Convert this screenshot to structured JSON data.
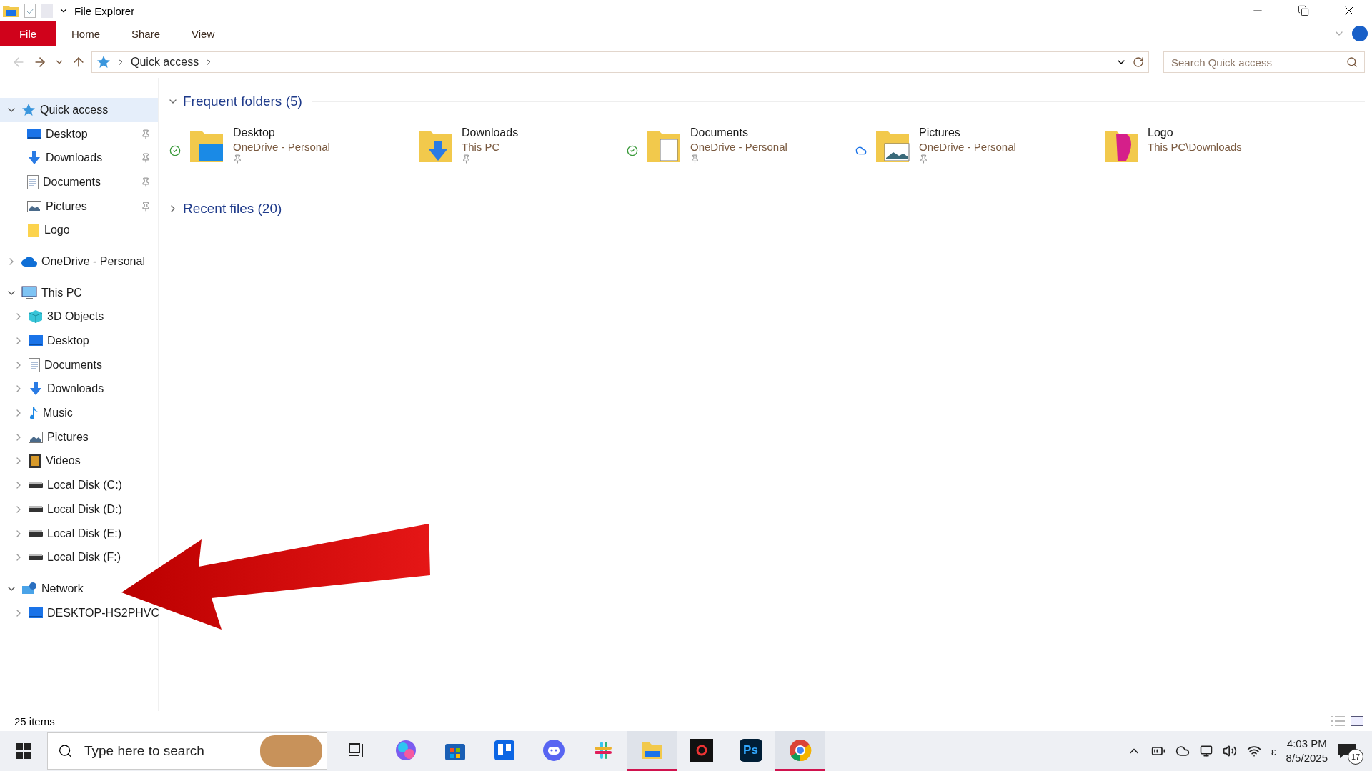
{
  "window": {
    "title": "File Explorer"
  },
  "ribbon": {
    "tabs": [
      {
        "label": "File",
        "kind": "file",
        "selected": false
      },
      {
        "label": "Home",
        "kind": "tab",
        "selected": false
      },
      {
        "label": "Share",
        "kind": "tab",
        "selected": false
      },
      {
        "label": "View",
        "kind": "tab",
        "selected": false
      }
    ]
  },
  "address": {
    "path": [
      "Quick access"
    ],
    "search_placeholder": "Search Quick access"
  },
  "sidebar": {
    "sections": [
      {
        "label": "Quick access",
        "kind": "star",
        "expanded": true,
        "selected": true,
        "children": [
          {
            "label": "Desktop",
            "kind": "desktop",
            "pinned": true
          },
          {
            "label": "Downloads",
            "kind": "downloads",
            "pinned": true
          },
          {
            "label": "Documents",
            "kind": "documents",
            "pinned": true
          },
          {
            "label": "Pictures",
            "kind": "pictures",
            "pinned": true
          },
          {
            "label": "Logo",
            "kind": "folder",
            "pinned": false
          }
        ]
      },
      {
        "label": "OneDrive - Personal",
        "kind": "cloud",
        "expanded": false,
        "selected": false
      },
      {
        "label": "This PC",
        "kind": "pc",
        "expanded": true,
        "selected": false,
        "children": [
          {
            "label": "3D Objects",
            "kind": "cube",
            "expanded": false
          },
          {
            "label": "Desktop",
            "kind": "desktop",
            "expanded": false
          },
          {
            "label": "Documents",
            "kind": "documents",
            "expanded": false
          },
          {
            "label": "Downloads",
            "kind": "downloads",
            "expanded": false
          },
          {
            "label": "Music",
            "kind": "music",
            "expanded": false
          },
          {
            "label": "Pictures",
            "kind": "pictures",
            "expanded": false
          },
          {
            "label": "Videos",
            "kind": "videos",
            "expanded": false
          },
          {
            "label": "Local Disk (C:)",
            "kind": "disk",
            "expanded": false
          },
          {
            "label": "Local Disk (D:)",
            "kind": "disk",
            "expanded": false
          },
          {
            "label": "Local Disk (E:)",
            "kind": "disk",
            "expanded": false
          },
          {
            "label": "Local Disk (F:)",
            "kind": "disk",
            "expanded": false
          }
        ]
      },
      {
        "label": "Network",
        "kind": "network",
        "expanded": true,
        "selected": false,
        "children": [
          {
            "label": "DESKTOP-HS2PHVC",
            "kind": "desktop",
            "expanded": false
          }
        ]
      }
    ]
  },
  "content": {
    "groups": [
      {
        "title": "Frequent folders (5)",
        "expanded": true,
        "items": [
          {
            "name": "Desktop",
            "location": "OneDrive - Personal",
            "kind": "desktop",
            "synced": true,
            "cloud_only": false,
            "pinned": true
          },
          {
            "name": "Downloads",
            "location": "This PC",
            "kind": "downloads",
            "synced": false,
            "cloud_only": false,
            "pinned": true
          },
          {
            "name": "Documents",
            "location": "OneDrive - Personal",
            "kind": "documents",
            "synced": true,
            "cloud_only": false,
            "pinned": true
          },
          {
            "name": "Pictures",
            "location": "OneDrive - Personal",
            "kind": "pictures",
            "synced": false,
            "cloud_only": true,
            "pinned": true
          },
          {
            "name": "Logo",
            "location": "This PC\\Downloads",
            "kind": "logo",
            "synced": false,
            "cloud_only": false,
            "pinned": false
          }
        ]
      },
      {
        "title": "Recent files (20)",
        "expanded": false
      }
    ]
  },
  "status_bar": {
    "text": "25 items"
  },
  "annotation": {
    "kind": "red-arrow"
  },
  "taskbar": {
    "search_placeholder": "Type here to search",
    "apps": [
      {
        "kind": "task-view",
        "running": false
      },
      {
        "kind": "copilot",
        "running": false
      },
      {
        "kind": "store",
        "running": false
      },
      {
        "kind": "trello",
        "running": false
      },
      {
        "kind": "discord",
        "running": false
      },
      {
        "kind": "slack",
        "running": false
      },
      {
        "kind": "explorer",
        "running": true
      },
      {
        "kind": "media",
        "running": false
      },
      {
        "kind": "photoshop",
        "label": "Ps",
        "running": false
      },
      {
        "kind": "chrome",
        "running": true
      }
    ],
    "input_indicator": "ε",
    "time": "4:03 PM",
    "date": "8/5/2025",
    "notification_count": "17"
  }
}
